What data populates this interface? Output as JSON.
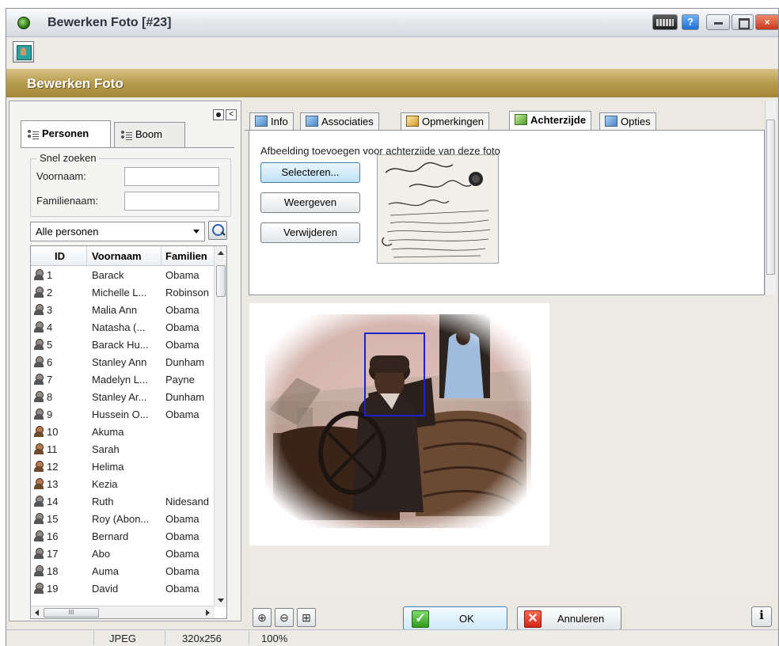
{
  "window": {
    "title": "Bewerken Foto [#23]",
    "help_label": "?",
    "close_label": "×"
  },
  "header": {
    "title": "Bewerken Foto"
  },
  "left_panel": {
    "tabs": [
      {
        "label": "Personen",
        "active": true
      },
      {
        "label": "Boom",
        "active": false
      }
    ],
    "quick_search": {
      "legend": "Snel zoeken",
      "first_name_label": "Voornaam:",
      "first_name_value": "",
      "last_name_label": "Familienaam:",
      "last_name_value": ""
    },
    "filter": {
      "selected": "Alle personen"
    },
    "table": {
      "columns": [
        "ID",
        "Voornaam",
        "Familien"
      ],
      "rows": [
        {
          "id": "1",
          "first": "Barack",
          "last": "Obama"
        },
        {
          "id": "2",
          "first": "Michelle L...",
          "last": "Robinson"
        },
        {
          "id": "3",
          "first": "Malia Ann",
          "last": "Obama"
        },
        {
          "id": "4",
          "first": "Natasha (...",
          "last": "Obama"
        },
        {
          "id": "5",
          "first": "Barack Hu...",
          "last": "Obama"
        },
        {
          "id": "6",
          "first": "Stanley Ann",
          "last": "Dunham"
        },
        {
          "id": "7",
          "first": "Madelyn L...",
          "last": "Payne"
        },
        {
          "id": "8",
          "first": "Stanley Ar...",
          "last": "Dunham"
        },
        {
          "id": "9",
          "first": "Hussein O...",
          "last": "Obama"
        },
        {
          "id": "10",
          "first": "Akuma",
          "last": ""
        },
        {
          "id": "11",
          "first": "Sarah",
          "last": ""
        },
        {
          "id": "12",
          "first": "Helima",
          "last": ""
        },
        {
          "id": "13",
          "first": "Kezia",
          "last": ""
        },
        {
          "id": "14",
          "first": "Ruth",
          "last": "Nidesand"
        },
        {
          "id": "15",
          "first": "Roy (Abon...",
          "last": "Obama"
        },
        {
          "id": "16",
          "first": "Bernard",
          "last": "Obama"
        },
        {
          "id": "17",
          "first": "Abo",
          "last": "Obama"
        },
        {
          "id": "18",
          "first": "Auma",
          "last": "Obama"
        },
        {
          "id": "19",
          "first": "David",
          "last": "Obama"
        }
      ],
      "hscroll_thumb": "III"
    }
  },
  "right_panel": {
    "tabs": [
      {
        "label": "Info",
        "icon": "info-icon"
      },
      {
        "label": "Associaties",
        "icon": "associations-icon"
      },
      {
        "label": "Opmerkingen",
        "icon": "notes-icon"
      },
      {
        "label": "Achterzijde",
        "icon": "photo-back-icon",
        "active": true
      },
      {
        "label": "Opties",
        "icon": "options-icon"
      }
    ],
    "back_side": {
      "description": "Afbeelding toevoegen voor achterzijde van deze foto",
      "select_button": "Selecteren...",
      "view_button": "Weergeven",
      "delete_button": "Verwijderen"
    }
  },
  "buttons": {
    "ok": "OK",
    "cancel": "Annuleren",
    "zoom_in": "⊕",
    "zoom_out": "⊖",
    "fit": "⊞",
    "info": "ℹ"
  },
  "statusbar": {
    "format": "JPEG",
    "dimensions": "320x256",
    "zoom": "100%"
  }
}
